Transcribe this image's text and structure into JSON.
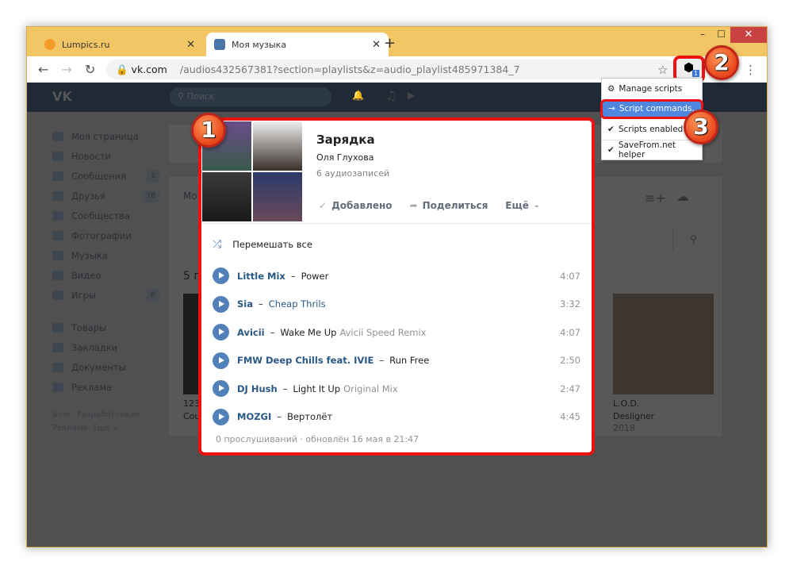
{
  "browser": {
    "tabs": [
      {
        "title": "Lumpics.ru"
      },
      {
        "title": "Моя музыка"
      }
    ],
    "url_host": "vk.com",
    "url_path": "/audios432567381?section=playlists&z=audio_playlist485971384_7",
    "extension_badge": "1"
  },
  "vk": {
    "search_placeholder": "Поиск"
  },
  "sidebar": {
    "items": [
      {
        "label": "Моя страница"
      },
      {
        "label": "Новости"
      },
      {
        "label": "Сообщения",
        "count": "2"
      },
      {
        "label": "Друзья",
        "count": "18"
      },
      {
        "label": "Сообщества"
      },
      {
        "label": "Фотографии"
      },
      {
        "label": "Музыка"
      },
      {
        "label": "Видео"
      },
      {
        "label": "Игры",
        "count": "6"
      }
    ],
    "items2": [
      {
        "label": "Товары"
      },
      {
        "label": "Закладки"
      },
      {
        "label": "Документы"
      },
      {
        "label": "Реклама"
      }
    ],
    "footer": [
      "Блог",
      "Разработчикам",
      "Реклама",
      "Ещё ⌄"
    ]
  },
  "background": {
    "tab_label": "Мо",
    "section_title": "5 п",
    "album_left_title": "123",
    "album_left_sub": "Cou",
    "album_right_title": "L.O.D.",
    "album_right_artist": "Desiigner",
    "album_right_year": "2018"
  },
  "playlist": {
    "title": "Зарядка",
    "owner": "Оля Глухова",
    "count": "6 аудиозаписей",
    "actions": {
      "added": "Добавлено",
      "share": "Поделиться",
      "more": "Ещё"
    },
    "shuffle": "Перемешать все",
    "tracks": [
      {
        "artist": "Little Mix",
        "title": "Power",
        "sub": "",
        "duration": "4:07",
        "link": false
      },
      {
        "artist": "Sia",
        "title": "Cheap Thrils",
        "sub": "",
        "duration": "3:32",
        "link": true
      },
      {
        "artist": "Avicii",
        "title": "Wake Me Up",
        "sub": "Avicii Speed Remix",
        "duration": "4:07",
        "link": false
      },
      {
        "artist": "FMW Deep Chills feat. IVIE",
        "title": "Run Free",
        "sub": "",
        "duration": "2:50",
        "link": false
      },
      {
        "artist": "DJ Hush",
        "title": "Light It Up",
        "sub": "Original Mix",
        "duration": "2:47",
        "link": false
      },
      {
        "artist": "MOZGI",
        "title": "Вертолёт",
        "sub": "",
        "duration": "4:45",
        "link": false
      }
    ],
    "footer": "0 прослушиваний · обновлён 16 мая в 21:47"
  },
  "menu": {
    "items": [
      "Manage scripts",
      "Script commands...",
      "Scripts enabled",
      "SaveFrom.net helper"
    ]
  },
  "badges": [
    "1",
    "2",
    "3"
  ]
}
